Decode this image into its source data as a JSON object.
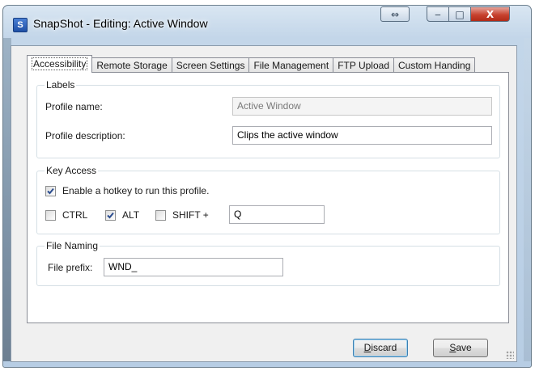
{
  "window": {
    "title": "SnapShot - Editing: Active Window",
    "app_icon_letter": "S",
    "controls": {
      "swap": "⇔",
      "minimize": "‒",
      "maximize": "□",
      "close": "X"
    }
  },
  "tabs": [
    {
      "label": "Accessibility",
      "active": true
    },
    {
      "label": "Remote Storage",
      "active": false
    },
    {
      "label": "Screen Settings",
      "active": false
    },
    {
      "label": "File Management",
      "active": false
    },
    {
      "label": "FTP Upload",
      "active": false
    },
    {
      "label": "Custom Handing",
      "active": false
    }
  ],
  "labels_group": {
    "title": "Labels",
    "profile_name_label": "Profile name:",
    "profile_name_value": "Active Window",
    "profile_name_enabled": false,
    "profile_description_label": "Profile description:",
    "profile_description_value": "Clips the active window"
  },
  "key_access_group": {
    "title": "Key Access",
    "enable_hotkey_label": "Enable a hotkey to run this profile.",
    "enable_hotkey_checked": true,
    "ctrl_label": "CTRL",
    "ctrl_checked": false,
    "alt_label": "ALT",
    "alt_checked": true,
    "shift_label": "SHIFT +",
    "shift_checked": false,
    "key_value": "Q"
  },
  "file_naming_group": {
    "title": "File Naming",
    "file_prefix_label": "File prefix:",
    "file_prefix_value": "WND_"
  },
  "buttons": {
    "discard": {
      "accel": "D",
      "rest": "iscard"
    },
    "save": {
      "accel": "S",
      "rest": "ave"
    }
  },
  "colors": {
    "close_button": "#c7422f",
    "check_mark": "#2b4d8f"
  }
}
